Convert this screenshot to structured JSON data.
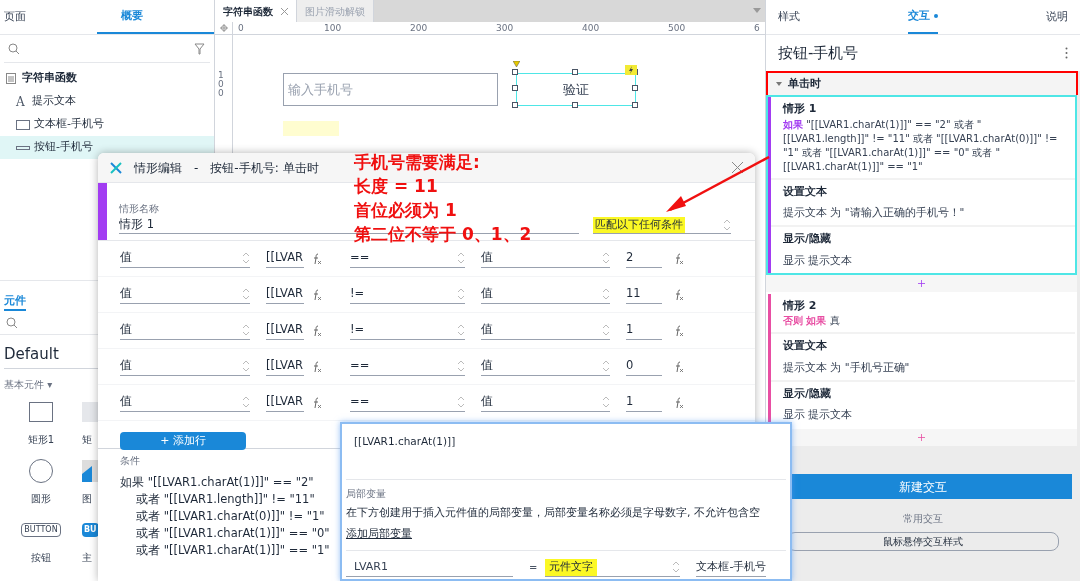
{
  "left_panel": {
    "tabs": [
      {
        "label": "页面",
        "selected": false
      },
      {
        "label": "概要",
        "selected": true
      }
    ],
    "outline": {
      "root": "字符串函数",
      "items": [
        {
          "label": "提示文本",
          "kind": "text",
          "icon_text": "A",
          "selected": false
        },
        {
          "label": "文本框-手机号",
          "kind": "field",
          "selected": false
        },
        {
          "label": "按钮-手机号",
          "kind": "button",
          "selected": true
        }
      ]
    },
    "library_tab": "元件",
    "library": "Default",
    "section": "基本元件 ▾",
    "widgets": [
      {
        "label": "矩形1",
        "kind": "rectangle"
      },
      {
        "label": "矩",
        "kind": "placeholder"
      },
      {
        "label": "圆形",
        "kind": "ellipse"
      },
      {
        "label": "图",
        "kind": "image"
      },
      {
        "label": "按钮",
        "kind": "button",
        "icon_text": "BUTTON"
      },
      {
        "label": "主",
        "kind": "primary",
        "icon_text": "BU"
      }
    ]
  },
  "canvas": {
    "tabs": [
      {
        "label": "字符串函数",
        "selected": true
      },
      {
        "label": "图片滑动解锁",
        "selected": false
      }
    ],
    "ruler_labels": [
      "0",
      "100",
      "200",
      "300",
      "400",
      "500",
      "6"
    ],
    "vertical_ruler_label": "100",
    "field_placeholder": "输入手机号",
    "button": {
      "label": "验证",
      "selected": true
    }
  },
  "dialog": {
    "title": "情形编辑",
    "separator": "-",
    "subtitle": "按钮-手机号: 单击时",
    "name_label": "情形名称",
    "name": "情形 1",
    "match": "匹配以下任何条件",
    "rows": [
      {
        "subject": "值",
        "target": "[[LVAR",
        "operator": "==",
        "compare": "值",
        "value": "2"
      },
      {
        "subject": "值",
        "target": "[[LVAR",
        "operator": "!=",
        "compare": "值",
        "value": "11"
      },
      {
        "subject": "值",
        "target": "[[LVAR",
        "operator": "!=",
        "compare": "值",
        "value": "1"
      },
      {
        "subject": "值",
        "target": "[[LVAR",
        "operator": "==",
        "compare": "值",
        "value": "0"
      },
      {
        "subject": "值",
        "target": "[[LVAR",
        "operator": "==",
        "compare": "值",
        "value": "1"
      }
    ],
    "add_row": "+ 添加行",
    "condition_label": "条件",
    "condition_lines": [
      "如果 \"[[LVAR1.charAt(1)]]\" == \"2\"",
      "或者 \"[[LVAR1.length]]\" != \"11\"",
      "或者 \"[[LVAR1.charAt(0)]]\" != \"1\"",
      "或者 \"[[LVAR1.charAt(1)]]\" == \"0\"",
      "或者 \"[[LVAR1.charAt(1)]]\" == \"1\""
    ]
  },
  "expression_dialog": {
    "expression": "[[LVAR1.charAt(1)]]",
    "section": "局部变量",
    "description": "在下方创建用于插入元件值的局部变量，局部变量名称必须是字母数字, 不允许包含空",
    "add_link": "添加局部变量",
    "variable": {
      "name": "LVAR1",
      "equals": "=",
      "type": "元件文字",
      "target": "文本框-手机号"
    }
  },
  "right_panel": {
    "tabs": [
      {
        "label": "样式",
        "selected": false
      },
      {
        "label": "交互",
        "selected": true
      },
      {
        "label": "说明",
        "selected": false
      }
    ],
    "title": "按钮-手机号",
    "event": "单击时",
    "cases": [
      {
        "name": "情形 1",
        "keyword": "如果",
        "condition": "\"[[LVAR1.charAt(1)]]\" == \"2\" 或者 \"[[LVAR1.length]]\" != \"11\" 或者 \"[[LVAR1.charAt(0)]]\" != \"1\" 或者 \"[[LVAR1.charAt(1)]]\" == \"0\" 或者 \"[[LVAR1.charAt(1)]]\" == \"1\"",
        "color": "#a23cf2",
        "selected": true,
        "actions": [
          {
            "title": "设置文本",
            "detail": "提示文本 为 \"请输入正确的手机号！\""
          },
          {
            "title": "显示/隐藏",
            "detail": "显示 提示文本"
          }
        ]
      },
      {
        "name": "情形 2",
        "keyword": "否则 如果",
        "condition": "真",
        "color": "#e84ea3",
        "selected": false,
        "actions": [
          {
            "title": "设置文本",
            "detail": "提示文本 为 \"手机号正确\""
          },
          {
            "title": "显示/隐藏",
            "detail": "显示 提示文本"
          }
        ]
      }
    ],
    "new_button": "新建交互",
    "common_label": "常用交互",
    "common_button": "鼠标悬停交互样式"
  },
  "annotation": [
    "手机号需要满足:",
    "长度 = 11",
    "首位必须为 1",
    "第二位不等于 0、1、2"
  ]
}
